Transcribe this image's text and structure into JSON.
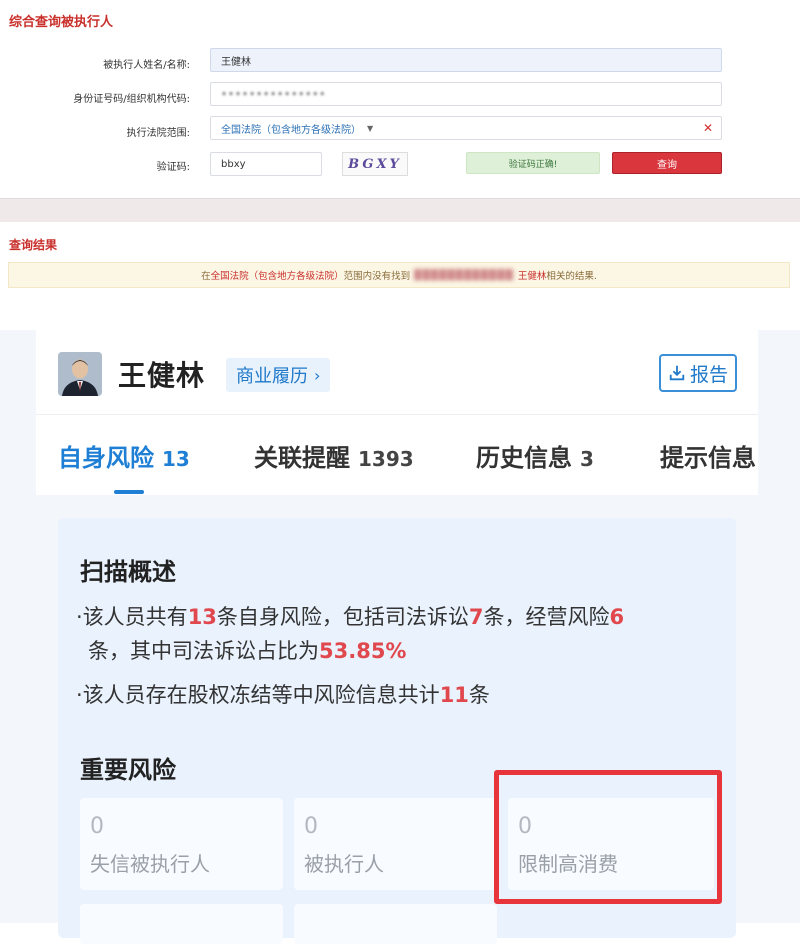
{
  "query_form": {
    "title": "综合查询被执行人",
    "name_label": "被执行人姓名/名称:",
    "name_value": "王健林",
    "id_label": "身份证号码/组织机构代码:",
    "id_value": "•••••••••••••••",
    "court_label": "执行法院范围:",
    "court_value": "全国法院（包含地方各级法院）",
    "captcha_label": "验证码:",
    "captcha_input": "bbxy",
    "captcha_image_text": "BGXY",
    "captcha_ok": "验证码正确!",
    "query_button": "查询"
  },
  "result": {
    "title": "查询结果",
    "prefix": "在",
    "scope": "全国法院（包含地方各级法院）",
    "middle": "范围内没有找到",
    "redacted": "████████████",
    "name": "王健林",
    "suffix": "相关的结果."
  },
  "profile": {
    "name": "王健林",
    "business_tag": "商业履历",
    "report_button": "报告"
  },
  "tabs": [
    {
      "label": "自身风险",
      "count": "13"
    },
    {
      "label": "关联提醒",
      "count": "1393"
    },
    {
      "label": "历史信息",
      "count": "3"
    },
    {
      "label": "提示信息",
      "count": ""
    }
  ],
  "scan": {
    "title": "扫描概述",
    "b1_part1": "该人员共有",
    "b1_n1": "13",
    "b1_part2": "条自身风险，包括司法诉讼",
    "b1_n2": "7",
    "b1_part3": "条，经营风险",
    "b1_n3": "6",
    "b1_part4": "条，其中司法诉讼占比为",
    "b1_pct": "53.85%",
    "b2_part1": "该人员存在股权冻结等中风险信息共计",
    "b2_n": "11",
    "b2_part2": "条"
  },
  "important": {
    "title": "重要风险",
    "items": [
      {
        "value": "0",
        "label": "失信被执行人"
      },
      {
        "value": "0",
        "label": "被执行人"
      },
      {
        "value": "0",
        "label": "限制高消费"
      }
    ]
  },
  "colors": {
    "accent_blue": "#1f7fd4",
    "risk_red": "#e0484e",
    "highlight_red": "#e8353b"
  }
}
